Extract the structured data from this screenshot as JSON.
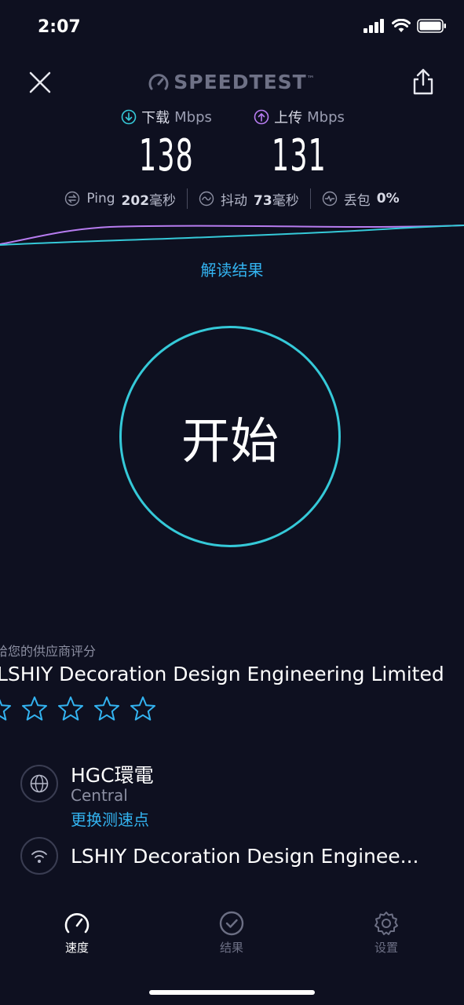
{
  "status_bar": {
    "time": "2:07"
  },
  "header": {
    "logo_text": "SPEEDTEST"
  },
  "metrics": {
    "download": {
      "label": "下载",
      "unit": "Mbps",
      "value": "138",
      "color": "#35c9d8"
    },
    "upload": {
      "label": "上传",
      "unit": "Mbps",
      "value": "131",
      "color": "#b77cf0"
    }
  },
  "stats": {
    "ping": {
      "label": "Ping",
      "value": "202",
      "unit": "毫秒"
    },
    "jitter": {
      "label": "抖动",
      "value": "73",
      "unit": "毫秒"
    },
    "loss": {
      "label": "丢包",
      "value": "0",
      "unit": "%"
    }
  },
  "interpret_link": "解读结果",
  "start_button": "开始",
  "rating": {
    "prompt": "给您的供应商评分",
    "provider": "LSHIY Decoration Design Engineering Limited",
    "stars_filled": 0,
    "stars_total": 5
  },
  "server": {
    "name": "HGC環電",
    "location": "Central",
    "change_link": "更换测速点"
  },
  "network": {
    "name": "LSHIY Decoration Design Enginee..."
  },
  "nav": {
    "speed": "速度",
    "results": "结果",
    "settings": "设置"
  },
  "colors": {
    "accent": "#35c9d8",
    "link": "#33b3f0",
    "upload": "#b77cf0",
    "background": "#0e1020"
  }
}
